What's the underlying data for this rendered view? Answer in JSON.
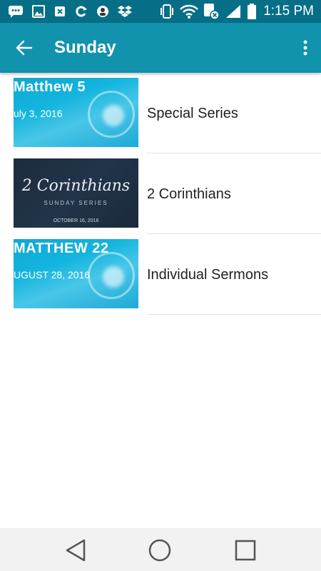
{
  "status_bar": {
    "time": "1:15 PM",
    "icons": [
      "message-icon",
      "image-icon",
      "app-x-icon",
      "sync-icon",
      "app-avatar-icon",
      "dropbox-icon",
      "vibrate-icon",
      "wifi-icon",
      "sim-icon",
      "signal-icon",
      "battery-icon"
    ]
  },
  "app_bar": {
    "title": "Sunday",
    "back_icon": "arrow-back-icon",
    "menu_icon": "more-vert-icon"
  },
  "items": [
    {
      "label": "Special Series",
      "thumbnail": {
        "title": "Matthew 5",
        "date": "uly 3, 2016"
      }
    },
    {
      "label": "2 Corinthians",
      "thumbnail": {
        "title": "2 Corinthians",
        "subtitle": "SUNDAY SERIES",
        "date": "OCTOBER 16, 2016"
      }
    },
    {
      "label": "Individual Sermons",
      "thumbnail": {
        "title": "MATTHEW 22",
        "date": "UGUST 28, 2016"
      }
    }
  ],
  "nav_bar": {
    "back_icon": "nav-back-icon",
    "home_icon": "nav-home-icon",
    "recents_icon": "nav-recents-icon"
  },
  "colors": {
    "status_bar": "#066f87",
    "app_bar": "#1192ad",
    "nav_bar": "#f2f2f2"
  }
}
